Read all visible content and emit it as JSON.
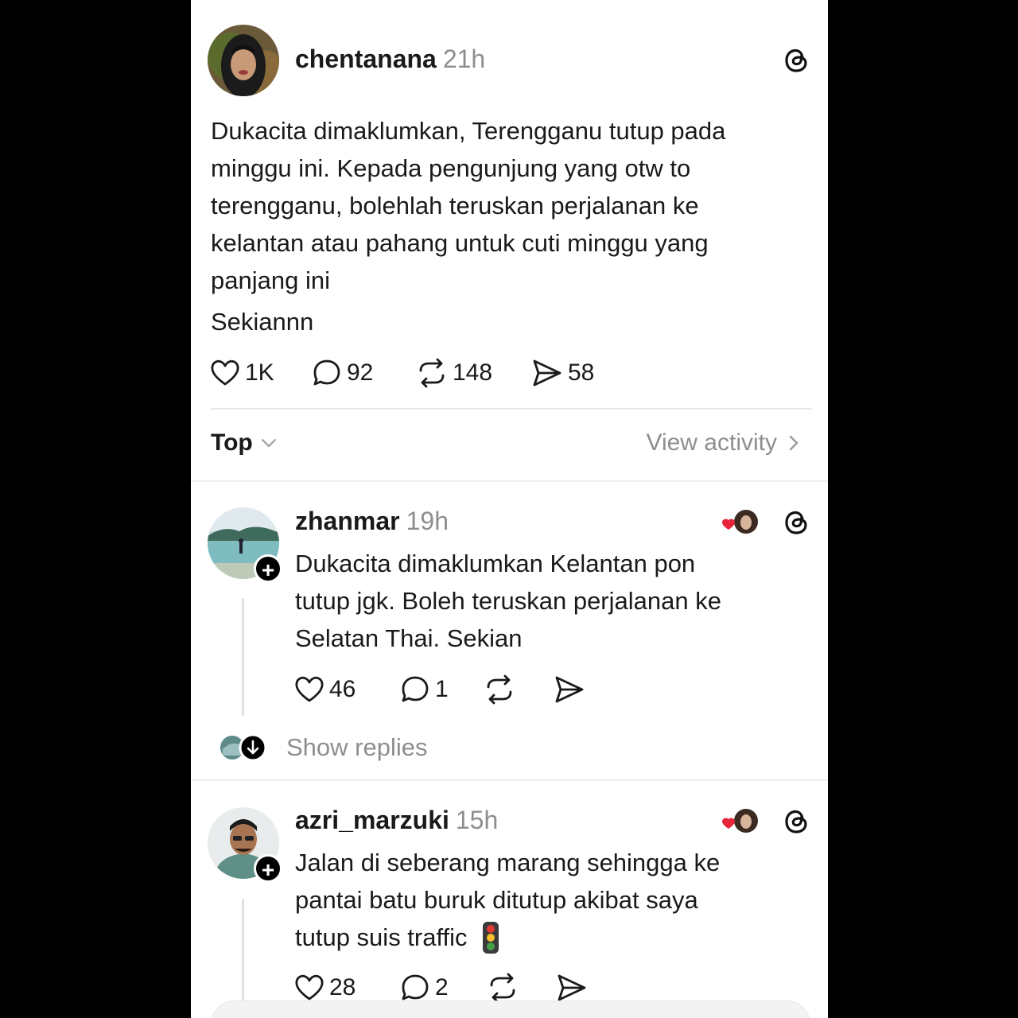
{
  "post": {
    "username": "chentanana",
    "time": "21h",
    "text_lines": [
      "Dukacita dimaklumkan, Terengganu tutup pada",
      "minggu ini. Kepada pengunjung yang otw to",
      "terengganu, bolehlah teruskan perjalanan ke",
      "kelantan atau pahang untuk cuti minggu yang",
      "panjang ini"
    ],
    "text_last": "Sekiannn",
    "likes": "1K",
    "replies": "92",
    "reposts": "148",
    "shares": "58"
  },
  "sort": {
    "label": "Top",
    "view_activity": "View activity"
  },
  "replies": [
    {
      "username": "zhanmar",
      "time": "19h",
      "text_lines": [
        "Dukacita dimaklumkan Kelantan pon",
        "tutup jgk. Boleh teruskan perjalanan ke",
        "Selatan Thai. Sekian"
      ],
      "likes": "46",
      "replies": "1",
      "show_replies": "Show replies"
    },
    {
      "username": "azri_marzuki",
      "time": "15h",
      "text_lines": [
        "Jalan di seberang marang sehingga ke",
        "pantai batu buruk ditutup akibat saya",
        "tutup suis traffic"
      ],
      "likes": "28",
      "replies": "2"
    }
  ],
  "colors": {
    "like_heart": "#e8243c",
    "muted_text": "#8e8e8e"
  }
}
